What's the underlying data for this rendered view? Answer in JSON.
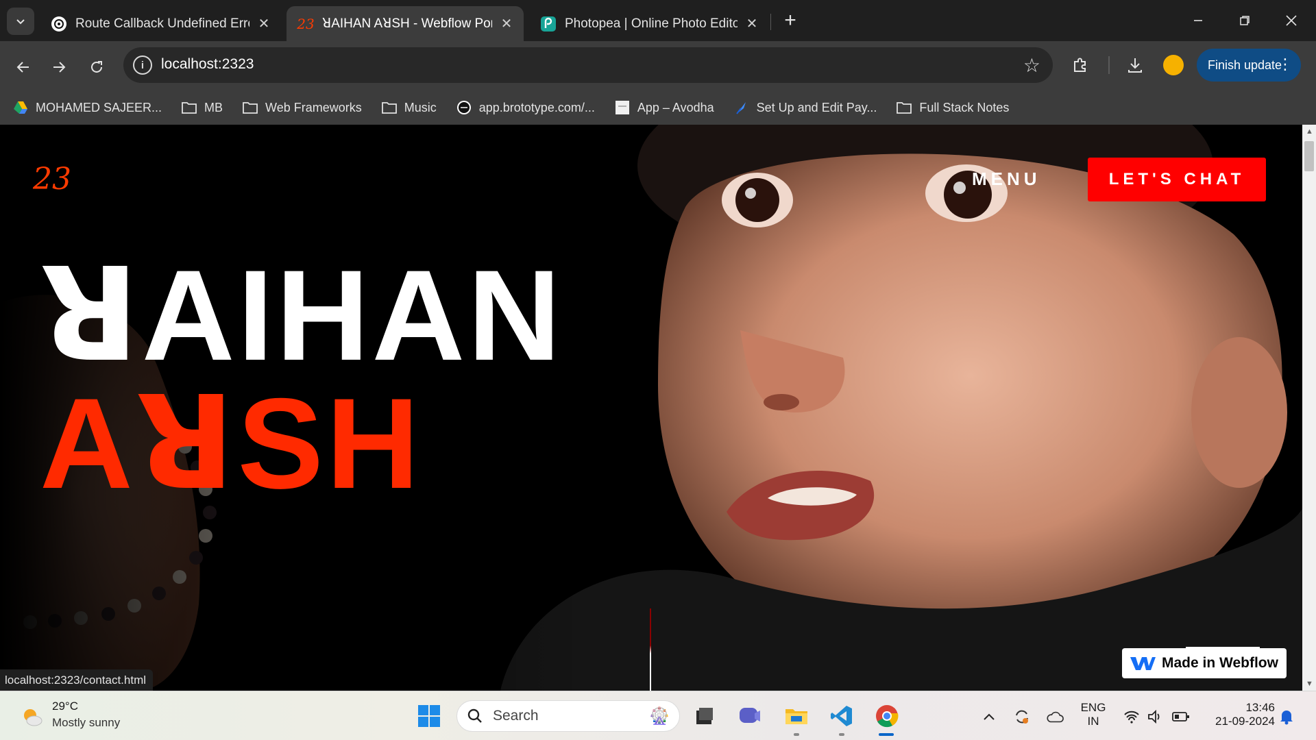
{
  "browser": {
    "tabs": [
      {
        "title": "Route Callback Undefined Error",
        "icon": "chatgpt-icon",
        "active": false
      },
      {
        "title": "ꓤAIHAN AꓤSH - Webflow Portfolio",
        "icon": "site-23-logo-icon",
        "active": true
      },
      {
        "title": "Photopea | Online Photo Editor",
        "icon": "photopea-icon",
        "active": false
      }
    ],
    "url": "localhost:2323",
    "update_label": "Finish update",
    "bookmarks": [
      {
        "label": "MOHAMED SAJEER...",
        "icon": "google-drive-icon"
      },
      {
        "label": "MB",
        "icon": "folder-icon"
      },
      {
        "label": "Web Frameworks",
        "icon": "folder-icon"
      },
      {
        "label": "Music",
        "icon": "folder-icon"
      },
      {
        "label": "app.brototype.com/...",
        "icon": "brototype-icon"
      },
      {
        "label": "App – Avodha",
        "icon": "page-icon"
      },
      {
        "label": "Set Up and Edit Pay...",
        "icon": "feather-icon"
      },
      {
        "label": "Full Stack Notes",
        "icon": "folder-icon"
      }
    ],
    "status_url": "localhost:2323/contact.html"
  },
  "page": {
    "logo": "23",
    "menu_label": "MENU",
    "cta_label": "LET'S CHAT",
    "hero_line1": "ꓤAIHAN",
    "hero_line2": "AꓤSH",
    "webflow_badge": "Made in Webflow",
    "accent_color": "#ff2a00"
  },
  "taskbar": {
    "weather_temp": "29°C",
    "weather_desc": "Mostly sunny",
    "search_placeholder": "Search",
    "apps": [
      "start-icon",
      "file-manager-icon",
      "chat-app-icon",
      "file-explorer-icon",
      "vscode-icon",
      "chrome-icon"
    ],
    "lang_line1": "ENG",
    "lang_line2": "IN",
    "time": "13:46",
    "date": "21-09-2024"
  }
}
